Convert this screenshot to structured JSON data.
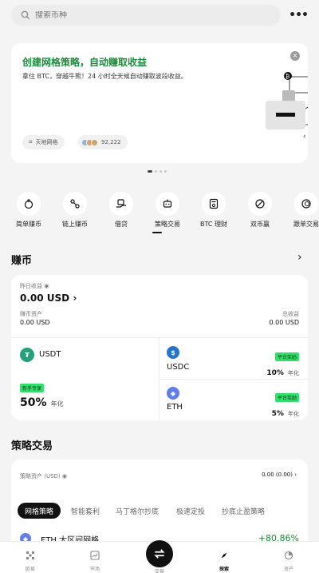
{
  "search": {
    "placeholder": "搜索币种"
  },
  "banner": {
    "title": "创建网格策略，自动赚取收益",
    "subtitle": "拿住 BTC，穿越牛熊！24 小时全天候自动赚取波段收益。",
    "tag": "天地网格",
    "users_count": "92,222"
  },
  "quick_nav": [
    {
      "label": "简单赚币",
      "icon": "piggy-icon"
    },
    {
      "label": "链上赚币",
      "icon": "chain-icon"
    },
    {
      "label": "借贷",
      "icon": "loan-icon"
    },
    {
      "label": "策略交易",
      "icon": "robot-icon"
    },
    {
      "label": "BTC 理财",
      "icon": "calculator-icon"
    },
    {
      "label": "双币赢",
      "icon": "dual-coin-icon"
    },
    {
      "label": "跟单交易",
      "icon": "copy-icon"
    }
  ],
  "earn": {
    "title": "赚币",
    "yesterday_label": "昨日收益",
    "yesterday_value": "0.00 USD",
    "assets_label": "赚币资产",
    "assets_value": "0.00 USD",
    "total_label": "总收益",
    "total_value": "0.00 USD",
    "usdt": {
      "name": "USDT",
      "badge": "新手专享",
      "rate": "50%",
      "rate_unit": "年化"
    },
    "usdc": {
      "name": "USDC",
      "badge": "平台奖励",
      "rate": "10%",
      "rate_unit": "年化"
    },
    "eth": {
      "name": "ETH",
      "badge": "平台奖励",
      "rate": "5%",
      "rate_unit": "年化"
    }
  },
  "strategy": {
    "title": "策略交易",
    "assets_label": "策略资产 (USD)",
    "assets_value": "0.00 (0.00)",
    "tabs": [
      "网格策略",
      "智能套利",
      "马丁格尔抄底",
      "极速定投",
      "抄底止盈策略"
    ],
    "item": {
      "name": "ETH 大区间网格",
      "return": "+80.86%"
    }
  },
  "bottom_nav": [
    {
      "label": "欧易"
    },
    {
      "label": "市场"
    },
    {
      "label": "交易"
    },
    {
      "label": "探索"
    },
    {
      "label": "资产"
    }
  ],
  "colors": {
    "accent_green": "#1c8a3a",
    "badge_green": "#2fe06a",
    "usdt": "#26a17b",
    "usdc": "#2775ca",
    "eth": "#627eea"
  }
}
